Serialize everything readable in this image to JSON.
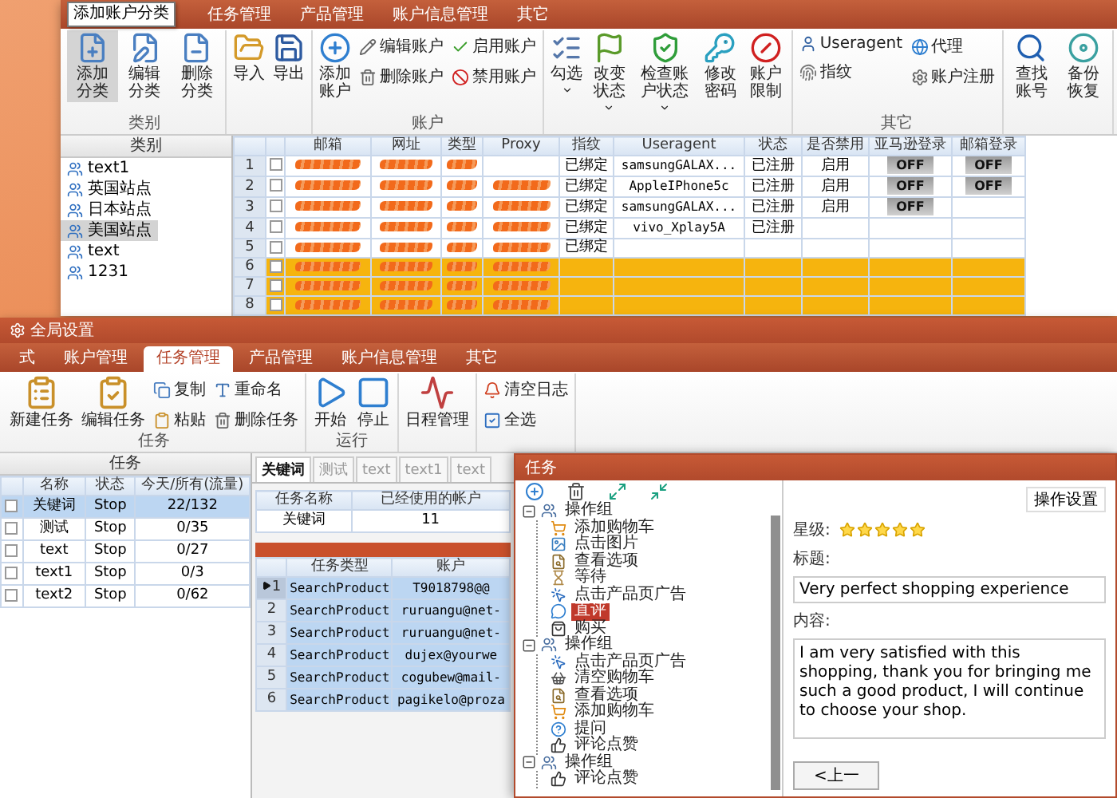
{
  "top_window": {
    "tabs": [
      {
        "label": "任务管理",
        "selected": false
      },
      {
        "label": "产品管理",
        "selected": false
      },
      {
        "label": "账户信息管理",
        "selected": false
      },
      {
        "label": "其它",
        "selected": false
      }
    ],
    "tooltip": "添加账户分类",
    "ribbon_groups": [
      {
        "label": "类别",
        "items": [
          {
            "kind": "large",
            "label": "添加分类",
            "selected": true
          },
          {
            "kind": "large",
            "label": "编辑分类",
            "selected": false
          },
          {
            "kind": "large",
            "label": "删除分类",
            "selected": false
          }
        ]
      },
      {
        "items": [
          {
            "kind": "large",
            "label": "导入",
            "selected": false
          },
          {
            "kind": "large",
            "label": "导出",
            "selected": false
          }
        ]
      },
      {
        "label": "账户",
        "items": [
          {
            "kind": "large",
            "label": "添加账户",
            "selected": false
          },
          {
            "kind": "small",
            "label": "编辑账户",
            "selected": false
          },
          {
            "kind": "small",
            "label": "删除账户",
            "selected": false
          },
          {
            "kind": "small",
            "label": "启用账户",
            "selected": false
          },
          {
            "kind": "small",
            "label": "禁用账户",
            "selected": false
          }
        ]
      },
      {
        "items": [
          {
            "kind": "large",
            "label": "勾选",
            "selected": false,
            "dropdown": true
          },
          {
            "kind": "large",
            "label": "改变状态",
            "selected": false,
            "dropdown": true
          },
          {
            "kind": "large",
            "label": "检查账户状态",
            "selected": false,
            "dropdown": true
          },
          {
            "kind": "large",
            "label": "修改密码",
            "selected": false,
            "dropdown": false
          },
          {
            "kind": "large",
            "label": "账户限制",
            "selected": false,
            "dropdown": false
          }
        ]
      },
      {
        "label": "其它",
        "items": [
          {
            "kind": "small",
            "label": "Useragent",
            "selected": false
          },
          {
            "kind": "small",
            "label": "指纹",
            "selected": false
          },
          {
            "kind": "small",
            "label": "代理",
            "selected": false
          },
          {
            "kind": "small",
            "label": "账户注册",
            "selected": false
          }
        ]
      },
      {
        "items": [
          {
            "kind": "large",
            "label": "查找账号",
            "selected": false
          },
          {
            "kind": "large",
            "label": "备份恢复",
            "selected": false
          }
        ]
      }
    ],
    "category_panel": {
      "title": "类别",
      "items": [
        {
          "label": "text1",
          "selected": false
        },
        {
          "label": "英国站点",
          "selected": false
        },
        {
          "label": "日本站点",
          "selected": false
        },
        {
          "label": "美国站点",
          "selected": true
        },
        {
          "label": "text",
          "selected": false
        },
        {
          "label": "1231",
          "selected": false
        }
      ]
    },
    "grid": {
      "columns": [
        "邮箱",
        "网址",
        "类型",
        "Proxy",
        "指纹",
        "Useragent",
        "状态",
        "是否禁用",
        "亚马逊登录",
        "邮箱登录"
      ],
      "rows": [
        {
          "number": "1",
          "highlighted": false,
          "fingerprint": "已绑定",
          "useragent": "samsungGALAX...",
          "status": "已注册",
          "disabled": "启用",
          "amazon_login": "OFF",
          "mail_login": "OFF"
        },
        {
          "number": "2",
          "highlighted": false,
          "fingerprint": "已绑定",
          "useragent": "AppleIPhone5c",
          "status": "已注册",
          "disabled": "启用",
          "amazon_login": "OFF",
          "mail_login": "OFF"
        },
        {
          "number": "3",
          "highlighted": false,
          "fingerprint": "已绑定",
          "useragent": "samsungGALAX...",
          "status": "已注册",
          "disabled": "启用",
          "amazon_login": "OFF"
        },
        {
          "number": "4",
          "highlighted": false,
          "fingerprint": "已绑定",
          "useragent": "vivo_Xplay5A",
          "status": "已注册"
        },
        {
          "number": "5",
          "highlighted": false,
          "fingerprint": "已绑定"
        },
        {
          "number": "6",
          "highlighted": true
        },
        {
          "number": "7",
          "highlighted": true
        },
        {
          "number": "8",
          "highlighted": true
        }
      ]
    }
  },
  "bottom_window": {
    "title": "全局设置",
    "tabs": [
      {
        "label": "式",
        "selected": false
      },
      {
        "label": "账户管理",
        "selected": false
      },
      {
        "label": "任务管理",
        "selected": true
      },
      {
        "label": "产品管理",
        "selected": false
      },
      {
        "label": "账户信息管理",
        "selected": false
      },
      {
        "label": "其它",
        "selected": false
      }
    ],
    "ribbon_groups": [
      {
        "label": "任务",
        "items": [
          {
            "kind": "large",
            "label": "新建任务"
          },
          {
            "kind": "large",
            "label": "编辑任务"
          },
          {
            "kind": "small",
            "label": "复制"
          },
          {
            "kind": "small",
            "label": "粘贴"
          },
          {
            "kind": "small",
            "label": "重命名"
          },
          {
            "kind": "small",
            "label": "删除任务"
          }
        ]
      },
      {
        "label": "运行",
        "items": [
          {
            "kind": "large",
            "label": "开始"
          },
          {
            "kind": "large",
            "label": "停止"
          }
        ]
      },
      {
        "items": [
          {
            "kind": "large",
            "label": "日程管理"
          }
        ]
      },
      {
        "items": [
          {
            "kind": "small",
            "label": "清空日志"
          },
          {
            "kind": "small",
            "label": "全选"
          }
        ]
      }
    ],
    "task_panel": {
      "title": "任务",
      "columns": [
        "名称",
        "状态",
        "今天/所有(流量)"
      ],
      "rows": [
        {
          "name": "关键词",
          "status": "Stop",
          "count": "22/132",
          "selected": true
        },
        {
          "name": "测试",
          "status": "Stop",
          "count": "0/35",
          "selected": false
        },
        {
          "name": "text",
          "status": "Stop",
          "count": "0/27",
          "selected": false
        },
        {
          "name": "text1",
          "status": "Stop",
          "count": "0/3",
          "selected": false
        },
        {
          "name": "text2",
          "status": "Stop",
          "count": "0/62",
          "selected": false
        }
      ]
    },
    "keyword_tabs": [
      {
        "label": "关键词",
        "selected": true
      },
      {
        "label": "测试",
        "selected": false
      },
      {
        "label": "text",
        "selected": false
      },
      {
        "label": "text1",
        "selected": false
      },
      {
        "label": "text",
        "selected": false
      }
    ],
    "usage_table": {
      "columns": [
        "任务名称",
        "已经使用的帐户"
      ],
      "rows": [
        [
          "关键词",
          "11"
        ]
      ]
    },
    "task_grid": {
      "columns": [
        "任务类型",
        "账户"
      ],
      "rows": [
        {
          "number": "1",
          "current": true,
          "type": "SearchProduct",
          "account": "T9018798@@"
        },
        {
          "number": "2",
          "current": false,
          "type": "SearchProduct",
          "account": "ruruangu@net-"
        },
        {
          "number": "3",
          "current": false,
          "type": "SearchProduct",
          "account": "ruruangu@net-"
        },
        {
          "number": "4",
          "current": false,
          "type": "SearchProduct",
          "account": "dujex@yourwe"
        },
        {
          "number": "5",
          "current": false,
          "type": "SearchProduct",
          "account": "cogubew@mail-"
        },
        {
          "number": "6",
          "current": false,
          "type": "SearchProduct",
          "account": "pagikelo@proza"
        }
      ]
    }
  },
  "task_dialog": {
    "title": "任务",
    "tree": [
      {
        "label": "操作组",
        "expanded": true,
        "children": [
          {
            "kind": "cart",
            "label": "添加购物车",
            "selected": false
          },
          {
            "kind": "image",
            "label": "点击图片",
            "selected": false
          },
          {
            "kind": "options",
            "label": "查看选项",
            "selected": false
          },
          {
            "kind": "wait",
            "label": "等待",
            "selected": false
          },
          {
            "kind": "ad",
            "label": "点击产品页广告",
            "selected": false
          },
          {
            "kind": "comment",
            "label": "直评",
            "selected": true
          },
          {
            "kind": "buy",
            "label": "购买",
            "selected": false
          }
        ]
      },
      {
        "label": "操作组",
        "expanded": true,
        "children": [
          {
            "kind": "ad",
            "label": "点击产品页广告",
            "selected": false
          },
          {
            "kind": "clear_cart",
            "label": "清空购物车",
            "selected": false
          },
          {
            "kind": "options",
            "label": "查看选项",
            "selected": false
          },
          {
            "kind": "cart",
            "label": "添加购物车",
            "selected": false
          },
          {
            "kind": "question",
            "label": "提问",
            "selected": false
          },
          {
            "kind": "like",
            "label": "评论点赞",
            "selected": false
          }
        ]
      },
      {
        "label": "操作组",
        "expanded": true,
        "children": [
          {
            "kind": "like",
            "label": "评论点赞",
            "selected": false
          }
        ]
      }
    ],
    "settings": {
      "title": "操作设置",
      "rating_label": "星级:",
      "stars": 5,
      "title_label": "标题:",
      "title_value": "Very perfect shopping experience",
      "content_label": "内容:",
      "content_value": "I am very satisfied with this shopping, thank you for bringing me such a good product, I will continue to choose your shop.",
      "prev_button": "<上一"
    }
  }
}
